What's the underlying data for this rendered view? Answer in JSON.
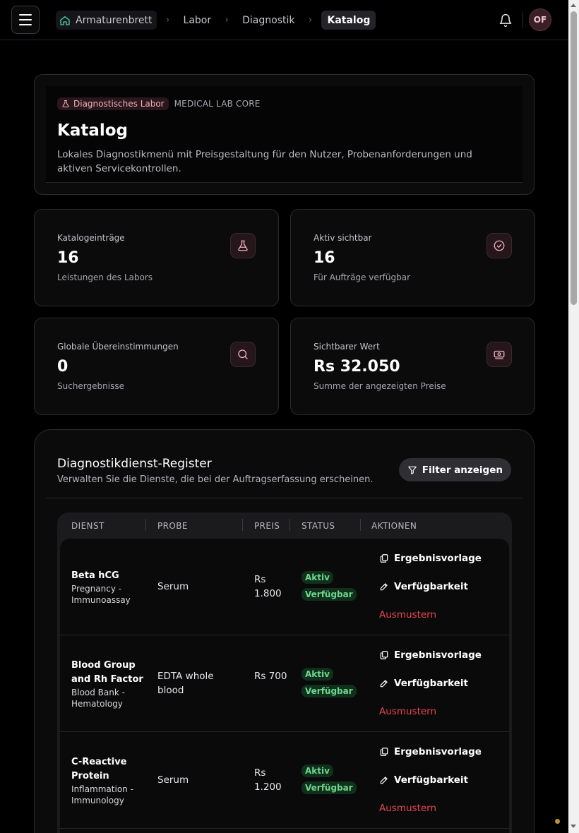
{
  "topbar": {
    "breadcrumbs": [
      "Armaturenbrett",
      "Labor",
      "Diagnostik",
      "Katalog"
    ],
    "avatar_initials": "OF"
  },
  "hero": {
    "chip_label": "Diagnostisches Labor",
    "chip_sub": "MEDICAL LAB CORE",
    "title": "Katalog",
    "description": "Lokales Diagnostikmenü mit Preisgestaltung für den Nutzer, Probenanforderungen und aktiven Servicekontrollen."
  },
  "stats": [
    {
      "label": "Katalogeinträge",
      "value": "16",
      "sub": "Leistungen des Labors",
      "icon": "flask-icon"
    },
    {
      "label": "Aktiv sichtbar",
      "value": "16",
      "sub": "Für Aufträge verfügbar",
      "icon": "check-circle-icon"
    },
    {
      "label": "Globale Übereinstimmungen",
      "value": "0",
      "sub": "Suchergebnisse",
      "icon": "search-icon"
    },
    {
      "label": "Sichtbarer Wert",
      "value": "Rs 32.050",
      "sub": "Summe der angezeigten Preise",
      "icon": "banknote-icon"
    }
  ],
  "register": {
    "title": "Diagnostikdienst-Register",
    "subtitle": "Verwalten Sie die Dienste, die bei der Auftragserfassung erscheinen.",
    "filter_label": "Filter anzeigen",
    "columns": [
      "DIENST",
      "PROBE",
      "PREIS",
      "STATUS",
      "AKTIONEN"
    ],
    "rows": [
      {
        "name": "Beta hCG",
        "category": "Pregnancy - Immunoassay",
        "sample": "Serum",
        "price": "Rs 1.800",
        "status": "Aktiv",
        "availability": "Verfügbar"
      },
      {
        "name": "Blood Group and Rh Factor",
        "category": "Blood Bank - Hematology",
        "sample": "EDTA whole blood",
        "price": "Rs 700",
        "status": "Aktiv",
        "availability": "Verfügbar"
      },
      {
        "name": "C-Reactive Protein",
        "category": "Inflammation - Immunology",
        "sample": "Serum",
        "price": "Rs 1.200",
        "status": "Aktiv",
        "availability": "Verfügbar"
      }
    ],
    "actions": {
      "template": "Ergebnisvorlage",
      "availability": "Verfügbarkeit",
      "retire": "Ausmustern"
    }
  },
  "colors": {
    "accent_pink": "#f1aebf",
    "success_green": "#6fd68f",
    "danger_red": "#e5484d"
  }
}
